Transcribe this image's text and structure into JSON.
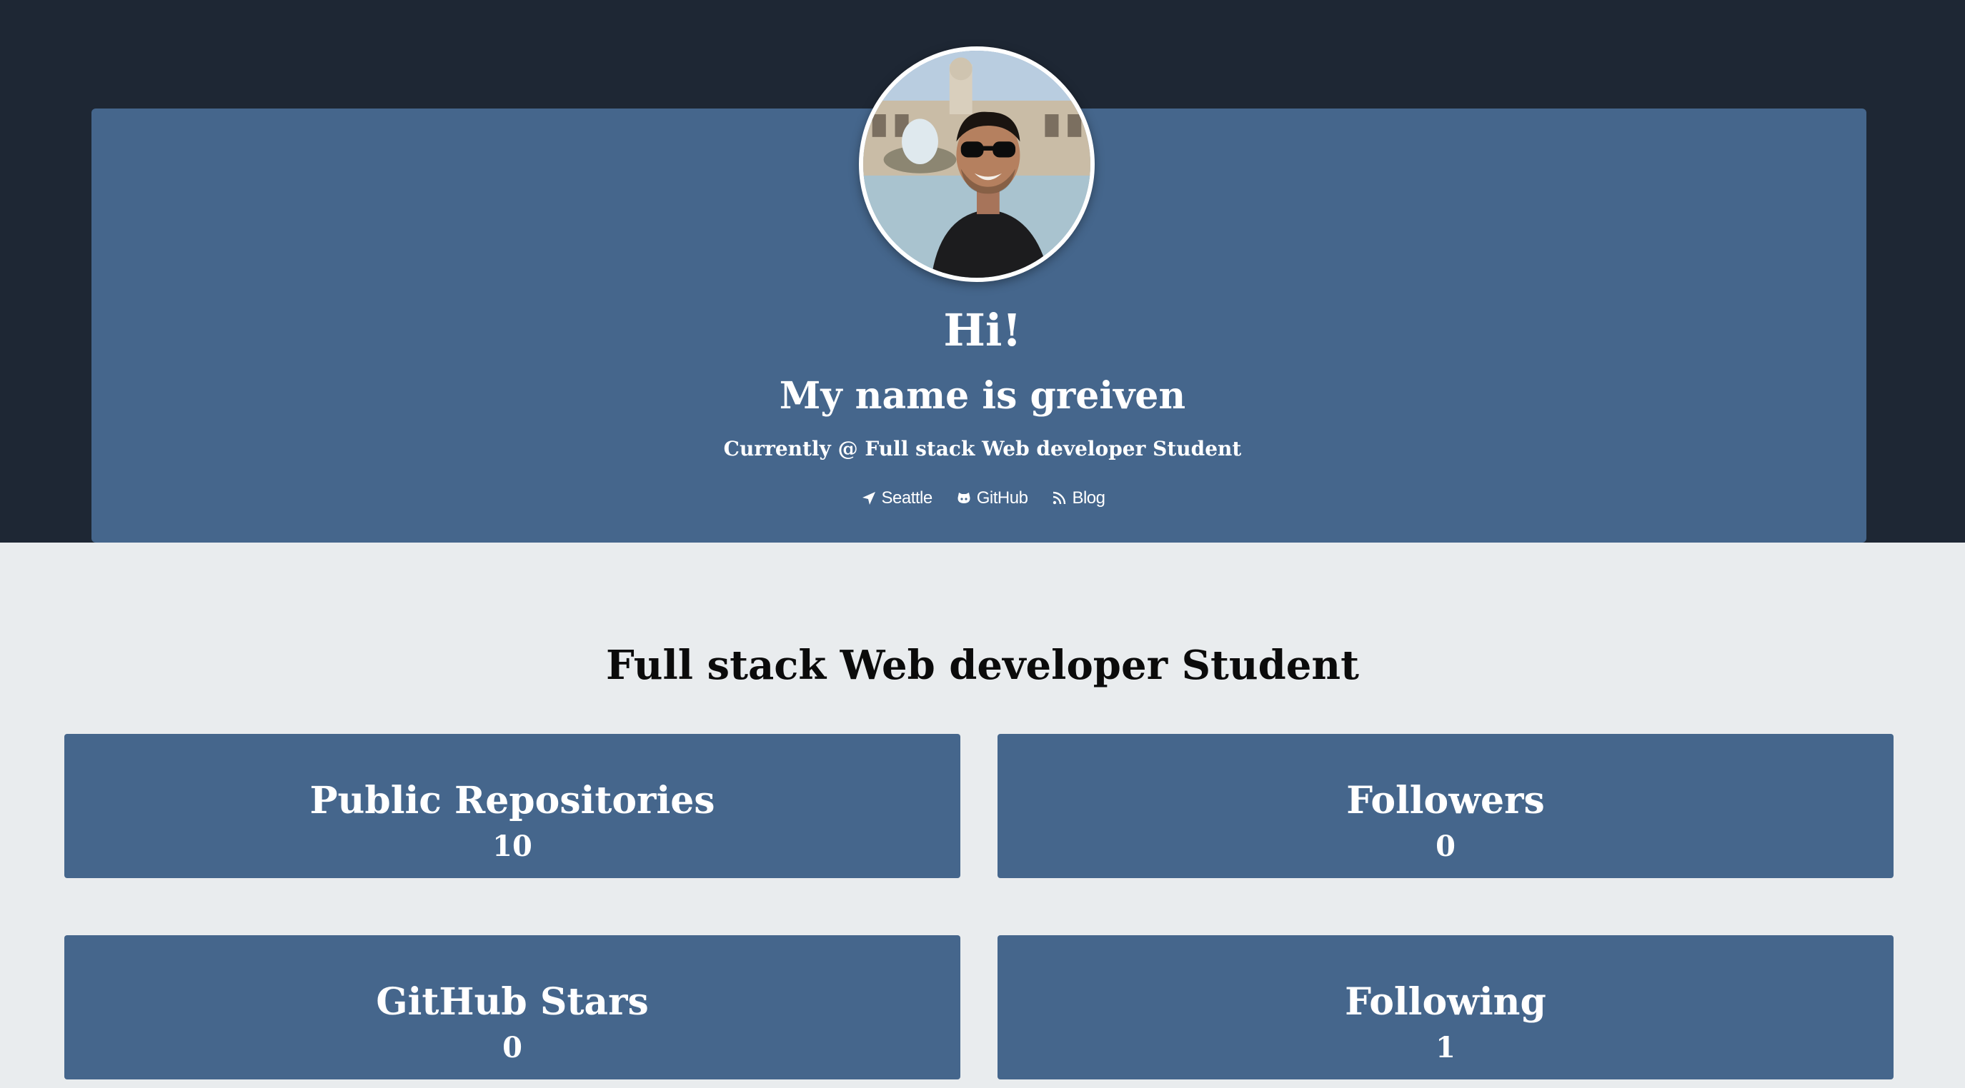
{
  "header": {
    "greeting": "Hi!",
    "name_line": "My name is greiven",
    "tagline": "Currently @ Full stack Web developer Student",
    "links": [
      {
        "label": "Seattle",
        "icon": "location-arrow-icon"
      },
      {
        "label": "GitHub",
        "icon": "github-icon"
      },
      {
        "label": "Blog",
        "icon": "rss-icon"
      }
    ]
  },
  "main": {
    "section_title": "Full stack Web developer Student",
    "stats": [
      {
        "label": "Public Repositories",
        "value": "10"
      },
      {
        "label": "Followers",
        "value": "0"
      },
      {
        "label": "GitHub Stars",
        "value": "0"
      },
      {
        "label": "Following",
        "value": "1"
      }
    ]
  },
  "colors": {
    "top_band": "#1e2734",
    "card_blue": "#45668c",
    "page_background": "#e9ecee",
    "text_light": "#ffffff",
    "text_dark": "#0b0b0b"
  }
}
